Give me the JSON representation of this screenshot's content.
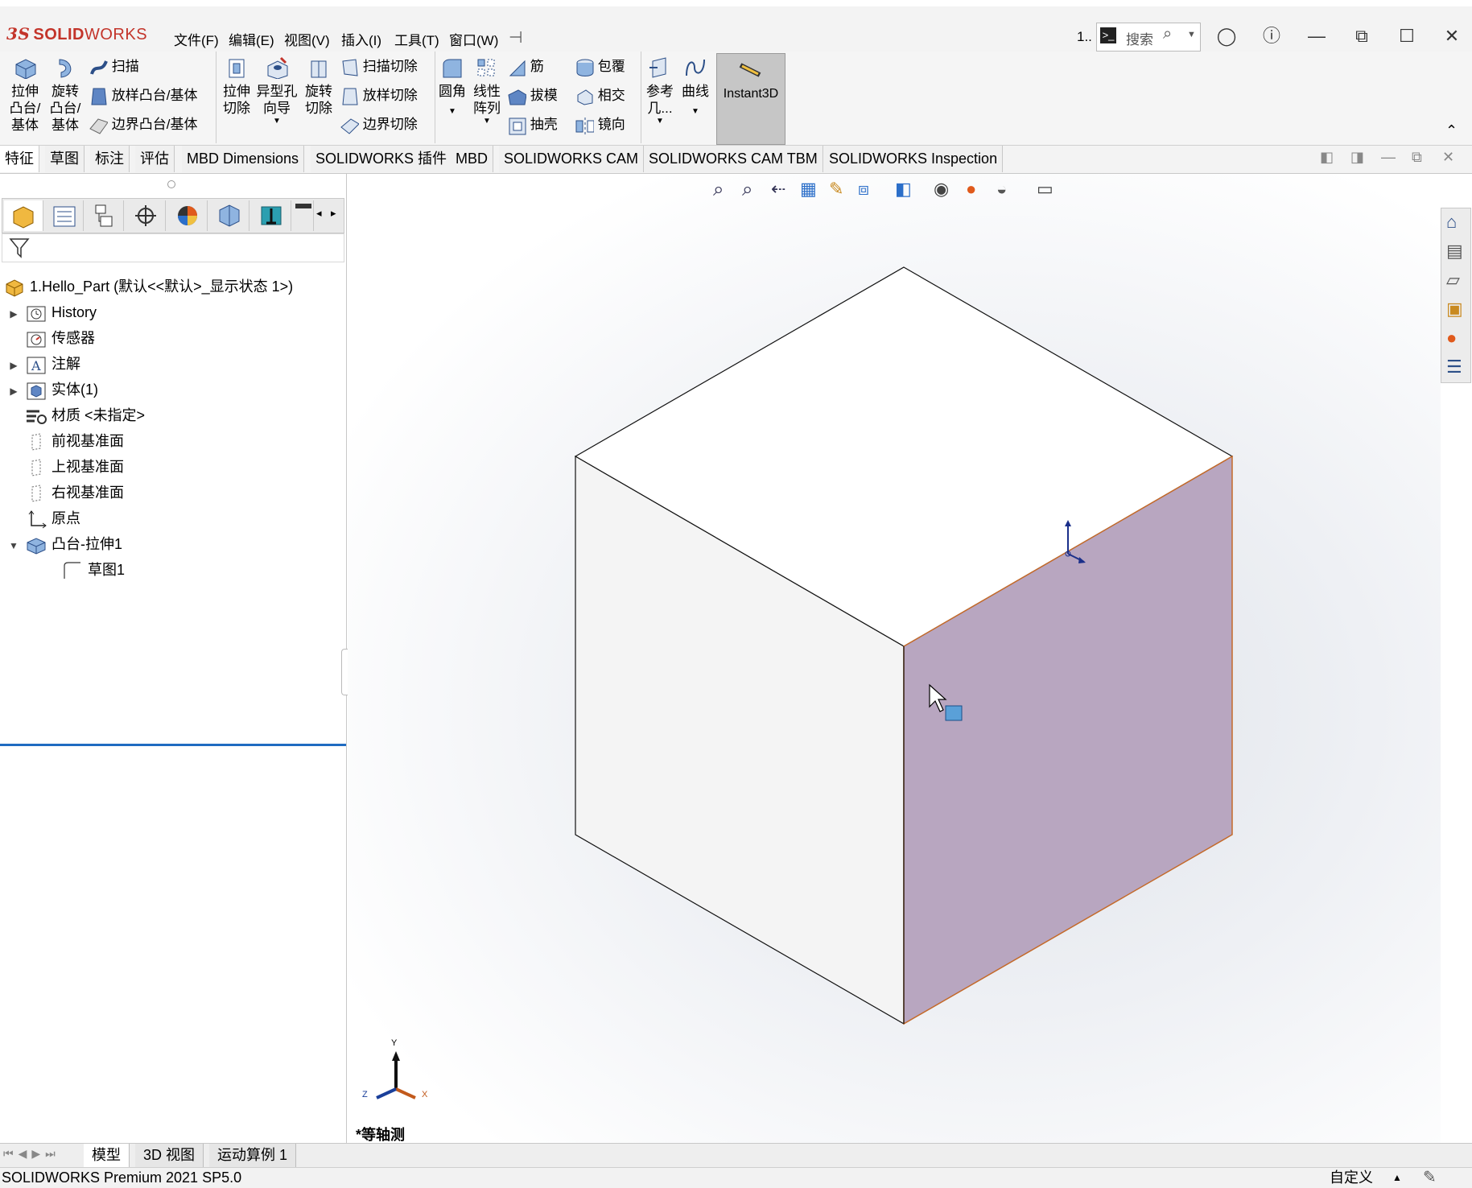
{
  "app": {
    "logo_ds": "3S",
    "logo_solid": "SOLID",
    "logo_works": "WORKS",
    "menus": [
      "文件(F)",
      "编辑(E)",
      "视图(V)",
      "插入(I)",
      "工具(T)",
      "窗口(W)"
    ],
    "doc_indicator": "1..",
    "search_placeholder": "搜索",
    "accent": "#c3342a"
  },
  "ribbon": {
    "extrude_boss": "拉伸\n凸台/\n基体",
    "revolve_boss": "旋转\n凸台/\n基体",
    "sweep": "扫描",
    "loft_boss": "放样凸台/基体",
    "boundary_boss": "边界凸台/基体",
    "extrude_cut": "拉伸\n切除",
    "hole_wizard": "异型孔\n向导",
    "revolve_cut": "旋转\n切除",
    "swept_cut": "扫描切除",
    "lofted_cut": "放样切除",
    "boundary_cut": "边界切除",
    "fillet": "圆角",
    "linear_pattern": "线性\n阵列",
    "rib": "筋",
    "draft": "拔模",
    "shell": "抽壳",
    "wrap": "包覆",
    "intersect": "相交",
    "mirror": "镜向",
    "reference_geometry": "参考\n几...",
    "curves": "曲线",
    "instant3d": "Instant3D"
  },
  "tabs": [
    "特征",
    "草图",
    "标注",
    "评估",
    "MBD Dimensions",
    "SOLIDWORKS 插件",
    "MBD",
    "SOLIDWORKS CAM",
    "SOLIDWORKS CAM TBM",
    "SOLIDWORKS Inspection"
  ],
  "tree": {
    "root": "1.Hello_Part  (默认<<默认>_显示状态 1>)",
    "items": [
      {
        "label": "History",
        "expander": true,
        "indent": 0
      },
      {
        "label": "传感器",
        "expander": false,
        "indent": 0
      },
      {
        "label": "注解",
        "expander": true,
        "indent": 0
      },
      {
        "label": "实体(1)",
        "expander": true,
        "indent": 0
      },
      {
        "label": "材质 <未指定>",
        "expander": false,
        "indent": 0
      },
      {
        "label": "前视基准面",
        "expander": false,
        "indent": 0
      },
      {
        "label": "上视基准面",
        "expander": false,
        "indent": 0
      },
      {
        "label": "右视基准面",
        "expander": false,
        "indent": 0
      },
      {
        "label": "原点",
        "expander": false,
        "indent": 0
      },
      {
        "label": "凸台-拉伸1",
        "expander": true,
        "expanded": true,
        "indent": 0
      },
      {
        "label": "草图1",
        "expander": false,
        "indent": 1
      }
    ]
  },
  "viewport": {
    "view_label": "*等轴测",
    "triad": {
      "x": "X",
      "y": "Y",
      "z": "Z"
    },
    "selected_face_color": "#b8a6c0"
  },
  "bottom_tabs": [
    "模型",
    "3D 视图",
    "运动算例 1"
  ],
  "status": {
    "left": "SOLIDWORKS Premium 2021 SP5.0",
    "right": "自定义"
  }
}
